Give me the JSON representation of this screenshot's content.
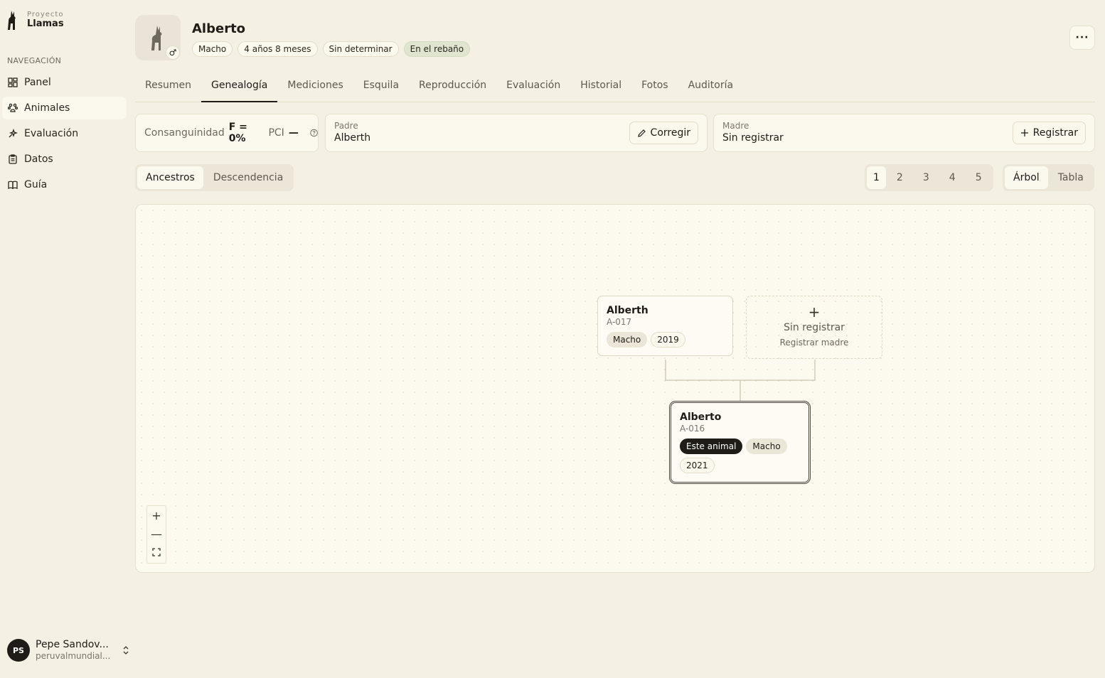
{
  "brand": {
    "small": "Proyecto",
    "big": "Llamas"
  },
  "nav": {
    "heading": "NAVEGACIÓN",
    "items": [
      {
        "label": "Panel",
        "icon": "grid-icon"
      },
      {
        "label": "Animales",
        "icon": "paw-icon",
        "active": true
      },
      {
        "label": "Evaluación",
        "icon": "sparkle-icon"
      },
      {
        "label": "Datos",
        "icon": "clipboard-icon"
      },
      {
        "label": "Guía",
        "icon": "book-icon"
      }
    ]
  },
  "user": {
    "initials": "PS",
    "name": "Pepe Sandov...",
    "email": "peruvalmundial..."
  },
  "animal": {
    "name": "Alberto",
    "sex_symbol": "♂",
    "chips": [
      "Macho",
      "4 años 8 meses",
      "Sin determinar",
      "En el rebaño"
    ]
  },
  "more_label": "···",
  "tabs": [
    "Resumen",
    "Genealogía",
    "Mediciones",
    "Esquila",
    "Reproducción",
    "Evaluación",
    "Historial",
    "Fotos",
    "Auditoría"
  ],
  "consanguinity": {
    "label": "Consanguinidad",
    "value": "F = 0%",
    "pci_label": "PCI",
    "pci_value": "—"
  },
  "father": {
    "label": "Padre",
    "value": "Alberth",
    "button": "Corregir"
  },
  "mother": {
    "label": "Madre",
    "value": "Sin registrar",
    "button": "Registrar"
  },
  "view_mode": [
    "Ancestros",
    "Descendencia"
  ],
  "generations": [
    "1",
    "2",
    "3",
    "4",
    "5"
  ],
  "layout_mode": [
    "Árbol",
    "Tabla"
  ],
  "tree": {
    "father": {
      "name": "Alberth",
      "id": "A-017",
      "tags": [
        "Macho",
        "2019"
      ]
    },
    "mother_empty": {
      "plus": "+",
      "title": "Sin registrar",
      "subtitle": "Registrar madre"
    },
    "self": {
      "name": "Alberto",
      "id": "A-016",
      "tags": [
        "Este animal",
        "Macho",
        "2021"
      ]
    }
  },
  "zoom": {
    "in": "+",
    "out": "—"
  },
  "colors": {
    "background": "#f4f0e3",
    "card": "#fbf8ee",
    "accent_dark": "#1f1c18",
    "status_green": "#dfe5cf"
  }
}
